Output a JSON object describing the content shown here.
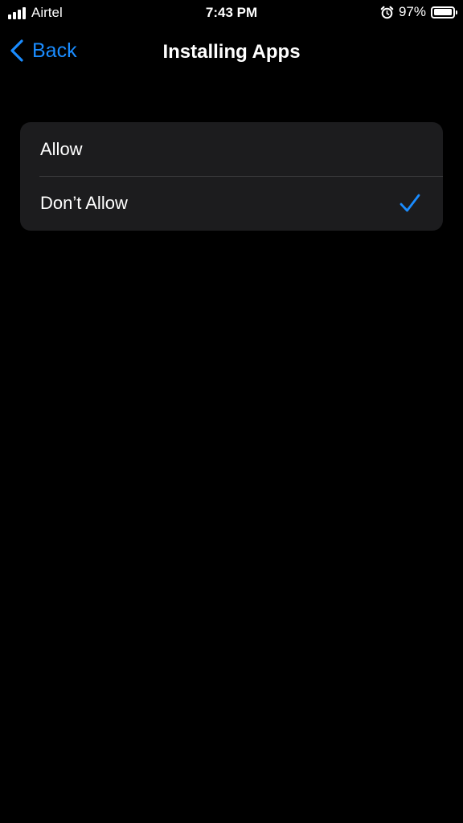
{
  "status_bar": {
    "carrier": "Airtel",
    "time": "7:43 PM",
    "battery_percent": "97%",
    "battery_level": 0.97,
    "signal_bars": 4,
    "alarm_icon": "alarm-clock-icon"
  },
  "nav": {
    "back_label": "Back",
    "title": "Installing Apps"
  },
  "options": [
    {
      "label": "Allow",
      "selected": false
    },
    {
      "label": "Don’t Allow",
      "selected": true
    }
  ],
  "colors": {
    "accent": "#1a8cff",
    "background": "#000000",
    "group_background": "#1c1c1e",
    "separator": "#38383a",
    "text": "#ffffff"
  }
}
